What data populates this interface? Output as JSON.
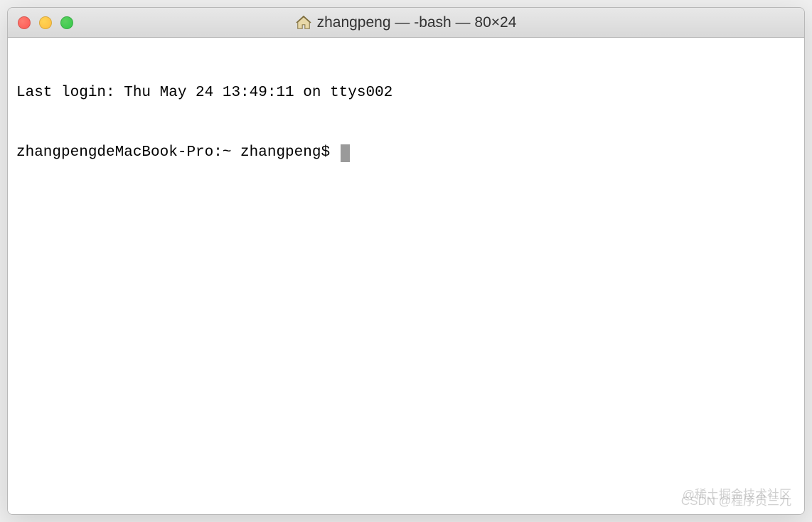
{
  "window": {
    "title": "zhangpeng — -bash — 80×24"
  },
  "terminal": {
    "last_login": "Last login: Thu May 24 13:49:11 on ttys002",
    "prompt": "zhangpengdeMacBook-Pro:~ zhangpeng$ "
  },
  "watermark": {
    "line1": "@稀土掘金技术社区",
    "line2": "CSDN @程序员三九"
  }
}
